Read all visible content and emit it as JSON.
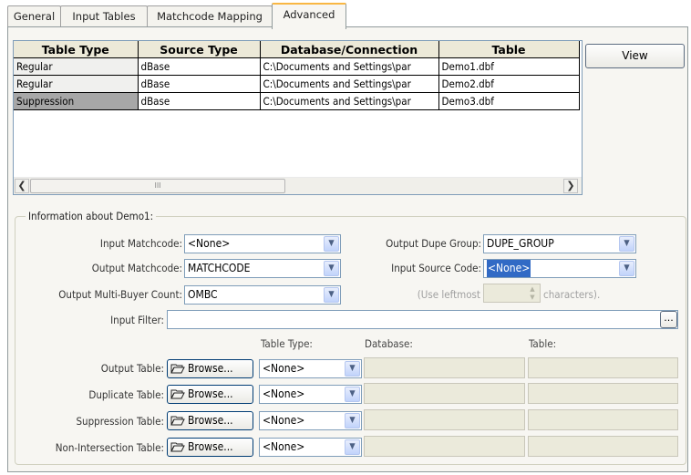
{
  "tabs": [
    {
      "label": "General"
    },
    {
      "label": "Input Tables"
    },
    {
      "label": "Matchcode Mapping"
    },
    {
      "label": "Advanced"
    }
  ],
  "grid": {
    "columns": [
      "Table Type",
      "Source Type",
      "Database/Connection",
      "Table"
    ],
    "rows": [
      {
        "table_type": "Regular",
        "source_type": "dBase",
        "database": "C:\\Documents and Settings\\par",
        "table": "Demo1.dbf"
      },
      {
        "table_type": "Regular",
        "source_type": "dBase",
        "database": "C:\\Documents and Settings\\par",
        "table": "Demo2.dbf"
      },
      {
        "table_type": "Suppression",
        "source_type": "dBase",
        "database": "C:\\Documents and Settings\\par",
        "table": "Demo3.dbf"
      }
    ],
    "selected_row": 3,
    "scroll_thumb_label": "III"
  },
  "view_button": "View",
  "info": {
    "title": "Information about Demo1:",
    "input_matchcode_label": "Input Matchcode:",
    "input_matchcode_value": "<None>",
    "output_matchcode_label": "Output Matchcode:",
    "output_matchcode_value": "MATCHCODE",
    "output_multibuyer_label": "Output Multi-Buyer Count:",
    "output_multibuyer_value": "OMBC",
    "output_dupe_group_label": "Output Dupe Group:",
    "output_dupe_group_value": "DUPE_GROUP",
    "input_source_code_label": "Input Source Code:",
    "input_source_code_value": "<None>",
    "use_leftmost_label": "(Use leftmost",
    "characters_label": "characters).",
    "input_filter_label": "Input Filter:",
    "input_filter_value": "",
    "ellipsis_button": "...",
    "col_table_type": "Table Type:",
    "col_database": "Database:",
    "col_table": "Table:",
    "browse_label": "Browse...",
    "rows": [
      {
        "label": "Output Table:",
        "type": "<None>"
      },
      {
        "label": "Duplicate Table:",
        "type": "<None>"
      },
      {
        "label": "Suppression Table:",
        "type": "<None>"
      },
      {
        "label": "Non-Intersection Table:",
        "type": "<None>"
      }
    ]
  },
  "colors": {
    "panel_bg": "#f7f6f2",
    "selected_row_header": "#a7a7a7",
    "highlight": "#316ac5",
    "active_tab_accent": "#f9b743"
  }
}
